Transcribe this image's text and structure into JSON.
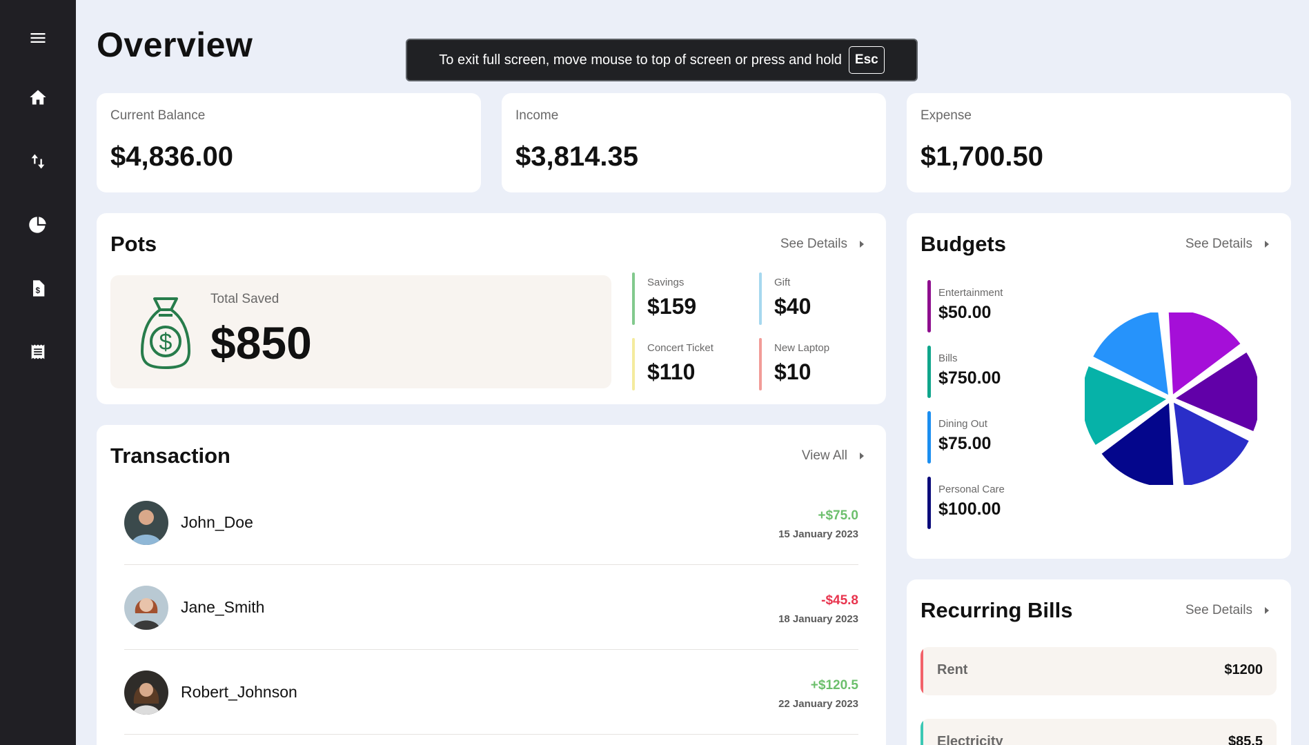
{
  "sidebar": {
    "items": [
      {
        "icon": "menu-icon"
      },
      {
        "icon": "home-icon"
      },
      {
        "icon": "transactions-icon"
      },
      {
        "icon": "budgets-pie-icon"
      },
      {
        "icon": "pots-document-icon"
      },
      {
        "icon": "recurring-bills-icon"
      }
    ]
  },
  "page": {
    "title": "Overview"
  },
  "toast": {
    "message": "To exit full screen, move mouse to top of screen or press and hold",
    "key": "Esc"
  },
  "stats": [
    {
      "label": "Current Balance",
      "value": "$4,836.00"
    },
    {
      "label": "Income",
      "value": "$3,814.35"
    },
    {
      "label": "Expense",
      "value": "$1,700.50"
    }
  ],
  "pots": {
    "title": "Pots",
    "link": "See Details",
    "total_label": "Total Saved",
    "total_value": "$850",
    "items": [
      {
        "label": "Savings",
        "value": "$159",
        "color": "#82c98d"
      },
      {
        "label": "Gift",
        "value": "$40",
        "color": "#a6d8ef"
      },
      {
        "label": "Concert Ticket",
        "value": "$110",
        "color": "#f4eb9e"
      },
      {
        "label": "New Laptop",
        "value": "$10",
        "color": "#f29c98"
      }
    ]
  },
  "transactions": {
    "title": "Transaction",
    "link": "View All",
    "items": [
      {
        "name": "John_Doe",
        "amount": "+$75.0",
        "date": "15 January 2023",
        "color": "#6cbf6c"
      },
      {
        "name": "Jane_Smith",
        "amount": "-$45.8",
        "date": "18 January 2023",
        "color": "#e8344e"
      },
      {
        "name": "Robert_Johnson",
        "amount": "+$120.5",
        "date": "22 January 2023",
        "color": "#6cbf6c"
      }
    ]
  },
  "budgets": {
    "title": "Budgets",
    "link": "See Details",
    "items": [
      {
        "label": "Entertainment",
        "value": "$50.00",
        "color": "#8e0e8e"
      },
      {
        "label": "Bills",
        "value": "$750.00",
        "color": "#0fa58b"
      },
      {
        "label": "Dining Out",
        "value": "$75.00",
        "color": "#1b8ef0"
      },
      {
        "label": "Personal Care",
        "value": "$100.00",
        "color": "#0a0a7a"
      }
    ],
    "chart_colors": [
      "#a50fd8",
      "#6100a8",
      "#2a2ec8",
      "#04068c",
      "#06b2a8",
      "#2693fb"
    ]
  },
  "recurring": {
    "title": "Recurring Bills",
    "link": "See Details",
    "items": [
      {
        "name": "Rent",
        "amount": "$1200",
        "color": "#f2626a"
      },
      {
        "name": "Electricity",
        "amount": "$85.5",
        "color": "#3cc8b4"
      }
    ]
  }
}
